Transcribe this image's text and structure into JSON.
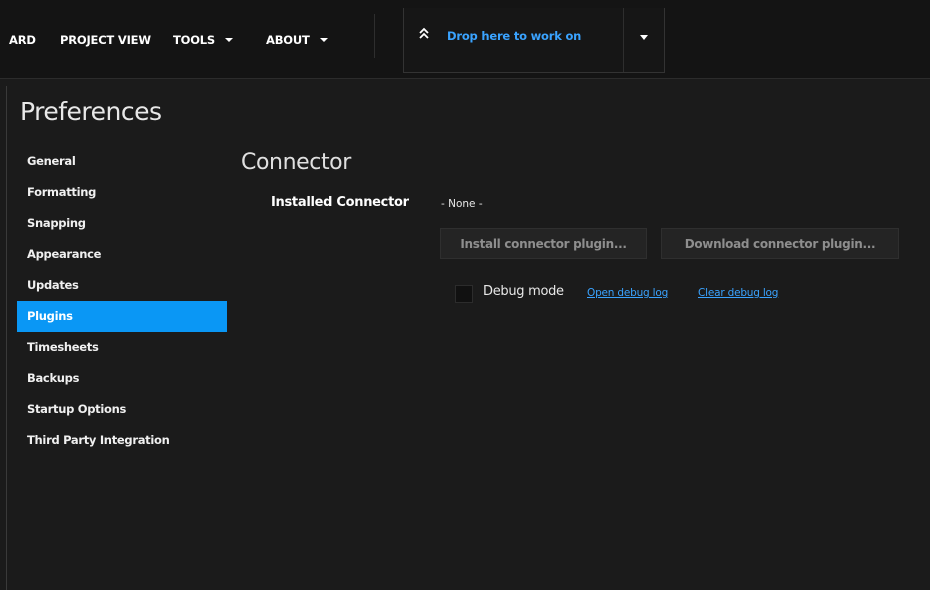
{
  "menu": {
    "items": [
      {
        "label": "ARD"
      },
      {
        "label": "PROJECT VIEW"
      },
      {
        "label": "TOOLS"
      },
      {
        "label": "ABOUT"
      }
    ],
    "drop_zone_label": "Drop here to work on"
  },
  "page_title": "Preferences",
  "sidebar": {
    "items": [
      {
        "label": "General"
      },
      {
        "label": "Formatting"
      },
      {
        "label": "Snapping"
      },
      {
        "label": "Appearance"
      },
      {
        "label": "Updates"
      },
      {
        "label": "Plugins"
      },
      {
        "label": "Timesheets"
      },
      {
        "label": "Backups"
      },
      {
        "label": "Startup Options"
      },
      {
        "label": "Third Party Integration"
      }
    ],
    "active": "Plugins"
  },
  "connector": {
    "section_title": "Connector",
    "installed_label": "Installed Connector",
    "installed_value": "- None -",
    "install_button": "Install connector plugin...",
    "download_button": "Download connector plugin...",
    "debug_label": "Debug mode",
    "debug_checked": false,
    "open_log_link": "Open debug log",
    "clear_log_link": "Clear debug log"
  },
  "colors": {
    "accent": "#0a97f5",
    "link": "#3aa3ff",
    "background": "#1b1b1b"
  }
}
